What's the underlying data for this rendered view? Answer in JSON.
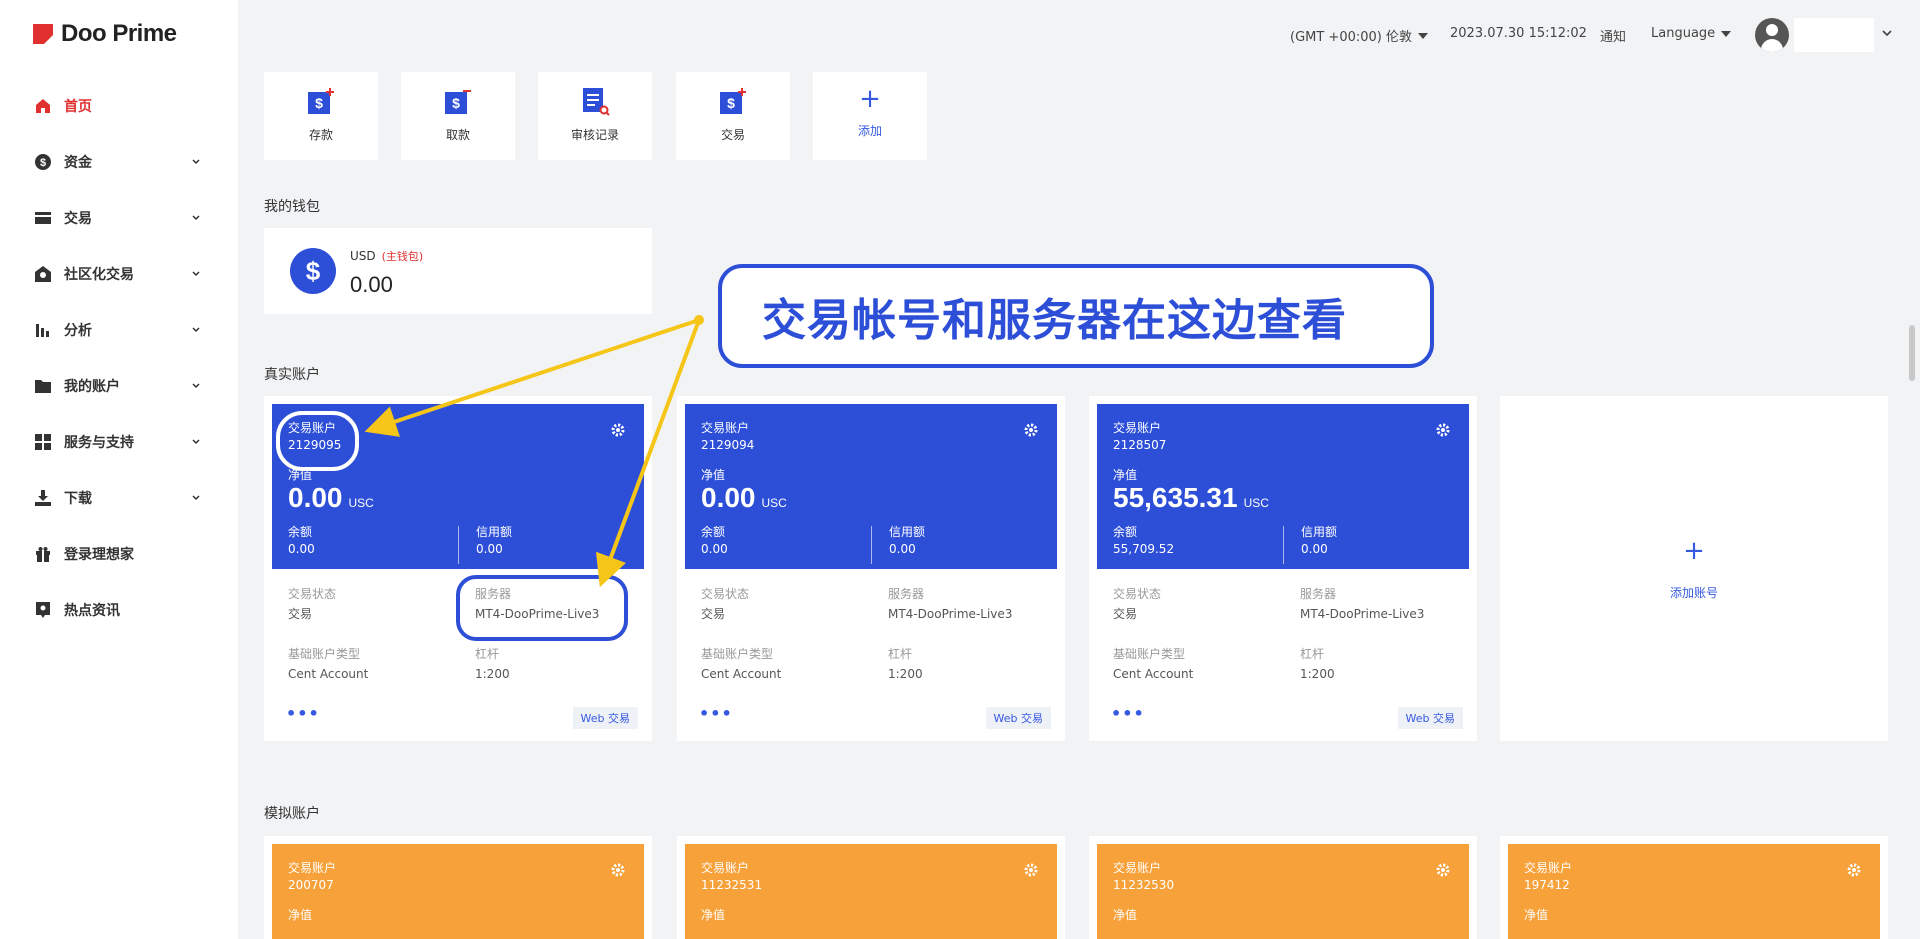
{
  "brand": "Doo Prime",
  "header": {
    "timezone": "(GMT +00:00) 伦敦",
    "datetime": "2023.07.30 15:12:02",
    "notice": "通知",
    "language": "Language"
  },
  "sidebar": {
    "items": [
      {
        "label": "首页",
        "icon": "home-icon"
      },
      {
        "label": "资金",
        "icon": "dollar-icon"
      },
      {
        "label": "交易",
        "icon": "card-icon"
      },
      {
        "label": "社区化交易",
        "icon": "community-icon"
      },
      {
        "label": "分析",
        "icon": "chart-icon"
      },
      {
        "label": "我的账户",
        "icon": "folder-icon"
      },
      {
        "label": "服务与支持",
        "icon": "grid-icon"
      },
      {
        "label": "下载",
        "icon": "download-icon"
      },
      {
        "label": "登录理想家",
        "icon": "gift-icon"
      },
      {
        "label": "热点资讯",
        "icon": "pin-icon"
      }
    ]
  },
  "quick_actions": [
    {
      "label": "存款"
    },
    {
      "label": "取款"
    },
    {
      "label": "审核记录"
    },
    {
      "label": "交易"
    },
    {
      "label": "添加",
      "plus": "+"
    }
  ],
  "wallet": {
    "title": "我的钱包",
    "currency": "USD",
    "main_tag": "(主钱包)",
    "balance": "0.00",
    "symbol": "$"
  },
  "real_accounts": {
    "title": "真实账户",
    "add_plus": "+",
    "add_label": "添加账号",
    "cards": [
      {
        "label": "交易账户",
        "number": "2129095",
        "net_label": "净值",
        "net": "0.00",
        "unit": "USC",
        "bal_label": "余额",
        "bal": "0.00",
        "credit_label": "信用额",
        "credit": "0.00",
        "status_label": "交易状态",
        "status": "交易",
        "server_label": "服务器",
        "server": "MT4-DooPrime-Live3",
        "type_label": "基础账户类型",
        "type": "Cent Account",
        "lev_label": "杠杆",
        "lev": "1:200",
        "more": "•••",
        "web": "Web 交易"
      },
      {
        "label": "交易账户",
        "number": "2129094",
        "net_label": "净值",
        "net": "0.00",
        "unit": "USC",
        "bal_label": "余额",
        "bal": "0.00",
        "credit_label": "信用额",
        "credit": "0.00",
        "status_label": "交易状态",
        "status": "交易",
        "server_label": "服务器",
        "server": "MT4-DooPrime-Live3",
        "type_label": "基础账户类型",
        "type": "Cent Account",
        "lev_label": "杠杆",
        "lev": "1:200",
        "more": "•••",
        "web": "Web 交易"
      },
      {
        "label": "交易账户",
        "number": "2128507",
        "net_label": "净值",
        "net": "55,635.31",
        "unit": "USC",
        "bal_label": "余额",
        "bal": "55,709.52",
        "credit_label": "信用额",
        "credit": "0.00",
        "status_label": "交易状态",
        "status": "交易",
        "server_label": "服务器",
        "server": "MT4-DooPrime-Live3",
        "type_label": "基础账户类型",
        "type": "Cent Account",
        "lev_label": "杠杆",
        "lev": "1:200",
        "more": "•••",
        "web": "Web 交易"
      }
    ]
  },
  "demo_accounts": {
    "title": "模拟账户",
    "cards": [
      {
        "label": "交易账户",
        "number": "200707",
        "net_label": "净值"
      },
      {
        "label": "交易账户",
        "number": "11232531",
        "net_label": "净值"
      },
      {
        "label": "交易账户",
        "number": "11232530",
        "net_label": "净值"
      },
      {
        "label": "交易账户",
        "number": "197412",
        "net_label": "净值"
      }
    ]
  },
  "annotation": {
    "callout": "交易帐号和服务器在这边查看"
  },
  "colors": {
    "brand_red": "#e03030",
    "card_blue": "#2d4fd8",
    "card_orange": "#f7a13a",
    "arrow": "#f5c518"
  }
}
